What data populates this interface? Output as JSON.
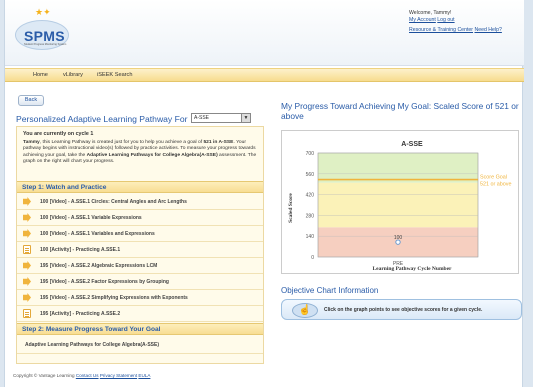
{
  "header": {
    "logo_text": "SPMS",
    "logo_subtext": "Student Progress Monitoring System",
    "welcome": "Welcome, Tammy!",
    "my_account": "My Account",
    "log_out": "Log out",
    "resource_center": "Resource & Training Center",
    "need_help": "Need Help?"
  },
  "nav": {
    "items": [
      "Home",
      "vLibrary",
      "iSEEK Search"
    ]
  },
  "back_label": "Back",
  "left": {
    "title": "Personalized Adaptive Learning Pathway For",
    "select_value": "A-SSE",
    "cycle_text": "You are currently on cycle 1",
    "intro_name": "Tammy",
    "intro_1": ", this Learning Pathway is created just for you to help you achieve a goal of ",
    "intro_goal": "521 in A-SSE",
    "intro_2": ". Your pathway begins with instructional video(s) followed by practice activities. To measure your progress towards achieving your goal, take the ",
    "intro_bold2": "Adaptive Learning Pathways for College Algebra(A-SSE)",
    "intro_3": " assessment. The graph on the right will chart your progress.",
    "step1": "Step 1: Watch and Practice",
    "items": [
      {
        "icon": "video",
        "label": "100  [Video] - A.SSE.1 Circles: Central Angles and Arc Lengths"
      },
      {
        "icon": "video",
        "label": "100  [Video] - A.SSE.1 Variable Expressions"
      },
      {
        "icon": "video",
        "label": "100  [Video] - A.SSE.1 Variables and Expressions"
      },
      {
        "icon": "doc",
        "label": "100  [Activity] - Practicing A.SSE.1"
      },
      {
        "icon": "video",
        "label": "195  [Video] - A.SSE.2 Algebraic Expressions LCM"
      },
      {
        "icon": "video",
        "label": "195  [Video] - A.SSE.2 Factor Expressions by Grouping"
      },
      {
        "icon": "video",
        "label": "195  [Video] - A.SSE.2 Simplifying Expressions with Exponents"
      },
      {
        "icon": "doc",
        "label": "195  [Activity] - Practicing A.SSE.2"
      }
    ],
    "step2": "Step 2: Measure Progress Toward Your Goal",
    "step2_item": "Adaptive Learning Pathways for College Algebra(A-SSE)"
  },
  "right": {
    "title": "My Progress Toward Achieving My Goal: Scaled Score of 521 or above",
    "objective_title": "Objective Chart Information",
    "hint": "Click on the graph points to see objective scores for a given cycle."
  },
  "footer": {
    "copyright": "Copyright © Vantage Learning",
    "contact": "Contact Us",
    "privacy": "Privacy Statement",
    "eula": "EULA"
  },
  "chart_data": {
    "type": "scatter",
    "title": "A-SSE",
    "xlabel": "Learning Pathway Cycle Number",
    "ylabel": "Scaled Score",
    "categories": [
      "PRE"
    ],
    "values": [
      100
    ],
    "ylim": [
      0,
      700
    ],
    "yticks": [
      0,
      140,
      280,
      420,
      560,
      700
    ],
    "goal": 521,
    "goal_label": "Score Goal 521 or above",
    "bands": [
      {
        "from": 0,
        "to": 200,
        "color": "#f6cfc0"
      },
      {
        "from": 200,
        "to": 500,
        "color": "#fbf2b8"
      },
      {
        "from": 500,
        "to": 700,
        "color": "#dff0c4"
      }
    ],
    "goal_color": "#f0b43c",
    "point_color": "#6b9bd1"
  },
  "colors": {
    "accent": "#2a5ca8",
    "nav": "#f7dc8e",
    "panel": "#fffbea"
  }
}
